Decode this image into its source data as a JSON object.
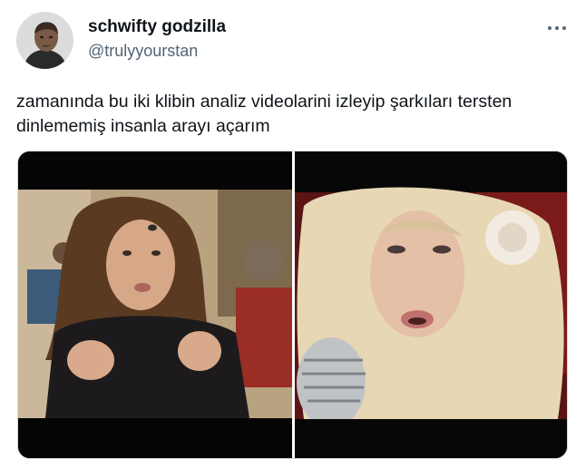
{
  "user": {
    "display_name": "schwifty godzilla",
    "handle": "@trulyyourstan",
    "avatar_icon": "user-avatar"
  },
  "more_icon": "more-options-icon",
  "tweet": {
    "text": "zamanında bu iki klibin analiz videolarini izleyip şarkıları tersten dinlememiş insanla arayı açarım"
  },
  "colors": {
    "text_primary": "#0f1419",
    "text_secondary": "#536471",
    "border": "#cfd9de"
  }
}
